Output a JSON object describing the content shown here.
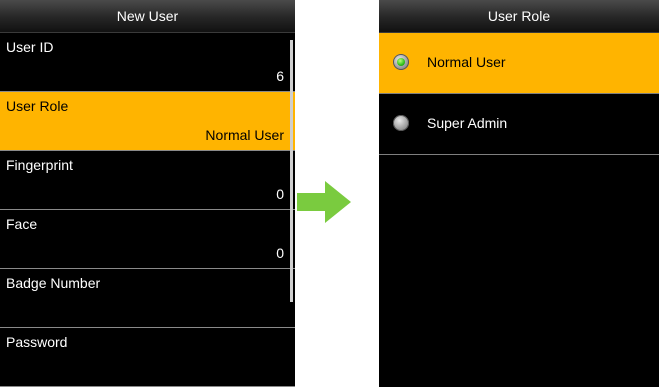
{
  "left_screen": {
    "title": "New User",
    "rows": [
      {
        "label": "User ID",
        "value": "6"
      },
      {
        "label": "User Role",
        "value": "Normal User"
      },
      {
        "label": "Fingerprint",
        "value": "0"
      },
      {
        "label": "Face",
        "value": "0"
      },
      {
        "label": "Badge Number",
        "value": ""
      },
      {
        "label": "Password",
        "value": ""
      }
    ],
    "selected_index": 1
  },
  "arrow": {
    "color": "#7acb3f",
    "icon": "arrow-right-icon"
  },
  "right_screen": {
    "title": "User Role",
    "options": [
      {
        "label": "Normal User",
        "selected": true
      },
      {
        "label": "Super Admin",
        "selected": false
      }
    ]
  },
  "colors": {
    "highlight": "#ffb400",
    "screen_bg": "#000000",
    "radio_selected": "#2fbf1a"
  }
}
